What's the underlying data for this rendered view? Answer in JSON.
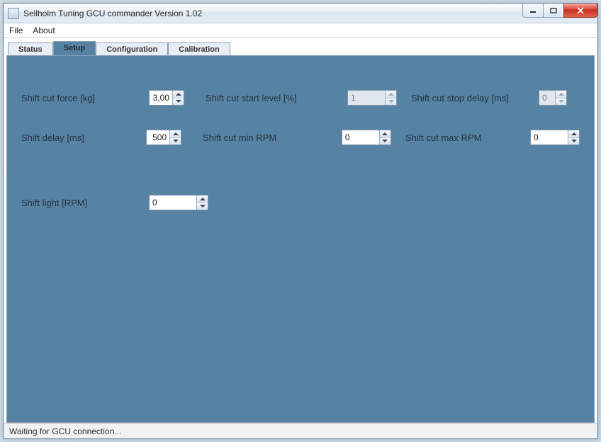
{
  "window": {
    "title": "Sellholm Tuning GCU commander Version 1.02"
  },
  "menu": {
    "file": "File",
    "about": "About"
  },
  "tabs": {
    "status": "Status",
    "setup": "Setup",
    "configuration": "Configuration",
    "calibration": "Calibration",
    "active": "setup"
  },
  "setup": {
    "shift_cut_force": {
      "label": "Shift cut force [kg]",
      "value": "3,00",
      "enabled": true
    },
    "shift_cut_start_level": {
      "label": "Shift cut start level [%]",
      "value": "1",
      "enabled": false
    },
    "shift_cut_stop_delay": {
      "label": "Shift cut stop delay [ms]",
      "value": "0",
      "enabled": false
    },
    "shift_delay": {
      "label": "Shift delay [ms]",
      "value": "500",
      "enabled": true
    },
    "shift_cut_min_rpm": {
      "label": "Shift cut min RPM",
      "value": "0",
      "enabled": true
    },
    "shift_cut_max_rpm": {
      "label": "Shift cut max RPM",
      "value": "0",
      "enabled": true
    },
    "shift_light_rpm": {
      "label": "Shift light [RPM]",
      "value": "0",
      "enabled": true
    }
  },
  "status_text": "Waiting for GCU connection..."
}
